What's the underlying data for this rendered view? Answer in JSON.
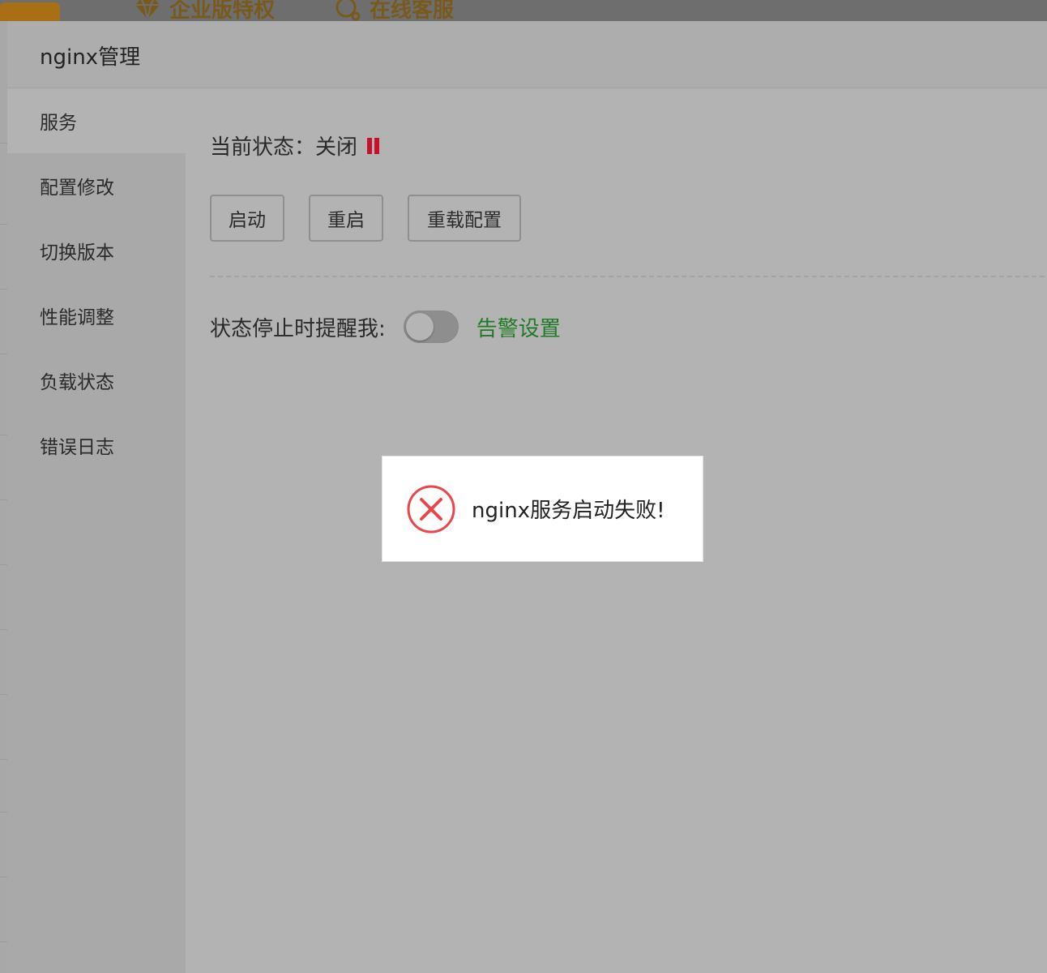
{
  "background": {
    "top_items": [
      {
        "icon": "diamond-icon",
        "label": "企业版特权"
      },
      {
        "icon": "chat-bubble-icon",
        "label": "在线客服"
      }
    ]
  },
  "dialog": {
    "title": "nginx管理"
  },
  "sidebar": {
    "items": [
      {
        "label": "服务",
        "active": true
      },
      {
        "label": "配置修改"
      },
      {
        "label": "切换版本"
      },
      {
        "label": "性能调整"
      },
      {
        "label": "负载状态"
      },
      {
        "label": "错误日志"
      }
    ]
  },
  "service": {
    "status_label": "当前状态：",
    "status_value": "关闭",
    "status_icon": "pause-icon",
    "status_color": "#c8102e",
    "buttons": {
      "start": "启动",
      "restart": "重启",
      "reload": "重载配置"
    },
    "remind_label": "状态停止时提醒我:",
    "remind_toggle_on": false,
    "alarm_link": "告警设置",
    "alarm_color": "#1f7a24"
  },
  "toast": {
    "icon": "error-circle-icon",
    "message": "nginx服务启动失败!",
    "icon_color": "#e8474a"
  }
}
